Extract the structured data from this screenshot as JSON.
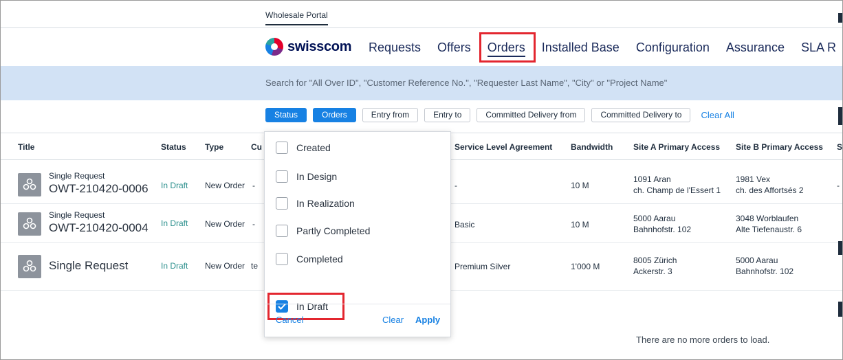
{
  "portal": {
    "tab": "Wholesale Portal"
  },
  "brand": {
    "logo_text": "swisscom"
  },
  "nav": {
    "items": [
      "Requests",
      "Offers",
      "Orders",
      "Installed Base",
      "Configuration",
      "Assurance",
      "SLA R"
    ],
    "active": "Orders"
  },
  "search": {
    "placeholder": "Search for \"All Over ID\", \"Customer Reference No.\", \"Requester Last Name\", \"City\" or \"Project Name\""
  },
  "filters": {
    "chips": [
      "Status",
      "Orders",
      "Entry from",
      "Entry to",
      "Committed Delivery from",
      "Committed Delivery to"
    ],
    "active_chips": [
      "Status",
      "Orders"
    ],
    "clear_all": "Clear All"
  },
  "table": {
    "headers": [
      "Title",
      "Status",
      "Type",
      "Cu",
      "Service Level Agreement",
      "Bandwidth",
      "Site A Primary Access",
      "Site B Primary Access",
      "Si"
    ],
    "rows": [
      {
        "title_small": "Single Request",
        "title_big": "OWT-210420-0006",
        "status": "In Draft",
        "type": "New Order",
        "cu": "-",
        "sla": "-",
        "bandwidth": "10 M",
        "site_a_1": "1091 Aran",
        "site_a_2": "ch. Champ de l'Essert 1",
        "site_b_1": "1981 Vex",
        "site_b_2": "ch. des Affortsés 2",
        "si": "-"
      },
      {
        "title_small": "Single Request",
        "title_big": "OWT-210420-0004",
        "status": "In Draft",
        "type": "New Order",
        "cu": "-",
        "sla": "Basic",
        "bandwidth": "10 M",
        "site_a_1": "5000 Aarau",
        "site_a_2": "Bahnhofstr. 102",
        "site_b_1": "3048 Worblaufen",
        "site_b_2": "Alte Tiefenaustr. 6",
        "si": ""
      },
      {
        "title_small": "",
        "title_big": "Single Request",
        "status": "In Draft",
        "type": "New Order",
        "cu": "te",
        "sla": "Premium Silver",
        "bandwidth": "1'000 M",
        "site_a_1": "8005 Zürich",
        "site_a_2": "Ackerstr. 3",
        "site_b_1": "5000 Aarau",
        "site_b_2": "Bahnhofstr. 102",
        "si": ""
      }
    ],
    "no_more": "There are no more orders to load."
  },
  "status_dropdown": {
    "options": [
      {
        "label": "Created",
        "checked": false
      },
      {
        "label": "In Design",
        "checked": false
      },
      {
        "label": "In Realization",
        "checked": false
      },
      {
        "label": "Partly Completed",
        "checked": false
      },
      {
        "label": "Completed",
        "checked": false
      },
      {
        "label": "In Draft",
        "checked": true
      }
    ],
    "cancel": "Cancel",
    "clear": "Clear",
    "apply": "Apply"
  },
  "colors": {
    "accent": "#1781e3",
    "highlight": "#e3262f",
    "status": "#2a8f8c",
    "search_bg": "#d2e2f5"
  }
}
